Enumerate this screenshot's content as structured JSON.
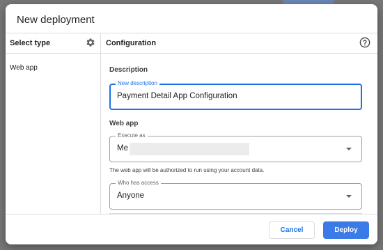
{
  "dialog": {
    "title": "New deployment",
    "select_type": {
      "heading": "Select type",
      "items": [
        "Web app"
      ]
    },
    "configuration": {
      "heading": "Configuration",
      "description_section": "Description",
      "description_field": {
        "label": "New description",
        "value": "Payment Detail App Configuration"
      },
      "web_app_section": "Web app",
      "execute_as": {
        "label": "Execute as",
        "value": "Me"
      },
      "helper_text": "The web app will be authorized to run using your account data.",
      "who_has_access": {
        "label": "Who has access",
        "value": "Anyone"
      }
    },
    "buttons": {
      "cancel": "Cancel",
      "deploy": "Deploy"
    }
  },
  "colors": {
    "accent": "#1a73e8",
    "deploy_button": "#3b7be8",
    "overlay": "#777777"
  },
  "icons": {
    "settings": "gear-icon",
    "help": "help-icon",
    "dropdown": "caret-down-icon"
  }
}
